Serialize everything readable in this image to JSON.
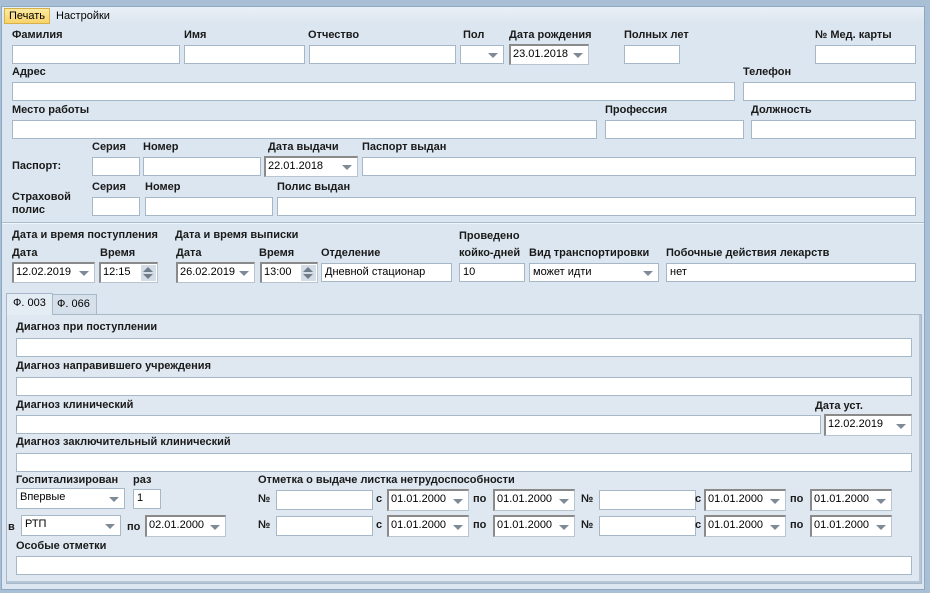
{
  "menu": {
    "print": "Печать",
    "settings": "Настройки"
  },
  "personal": {
    "last_name_label": "Фамилия",
    "last_name": "",
    "first_name_label": "Имя",
    "first_name": "",
    "patronymic_label": "Отчество",
    "patronymic": "",
    "sex_label": "Пол",
    "sex": "",
    "birth_date_label": "Дата рождения",
    "birth_date": "23.01.2018",
    "age_label": "Полных лет",
    "age": "",
    "card_no_label": "№ Мед. карты",
    "card_no": "",
    "address_label": "Адрес",
    "address": "",
    "phone_label": "Телефон",
    "phone": "",
    "workplace_label": "Место работы",
    "workplace": "",
    "profession_label": "Профессия",
    "profession": "",
    "position_label": "Должность",
    "position": ""
  },
  "passport": {
    "label": "Паспорт:",
    "series_label": "Серия",
    "series": "",
    "number_label": "Номер",
    "number": "",
    "issue_date_label": "Дата выдачи",
    "issue_date": "22.01.2018",
    "issued_by_label": "Паспорт выдан",
    "issued_by": ""
  },
  "insurance": {
    "label_line1": "Страховой",
    "label_line2": "полис",
    "series_label": "Серия",
    "series": "",
    "number_label": "Номер",
    "number": "",
    "issued_by_label": "Полис выдан",
    "issued_by": ""
  },
  "stay": {
    "admission_label": "Дата и время поступления",
    "discharge_label": "Дата и время выписки",
    "date_label": "Дата",
    "time_label": "Время",
    "admission_date": "12.02.2019",
    "admission_time": "12:15",
    "discharge_date": "26.02.2019",
    "discharge_time": "13:00",
    "department_label": "Отделение",
    "department": "Дневной стационар",
    "bed_days_label1": "Проведено",
    "bed_days_label2": "койко-дней",
    "bed_days": "10",
    "transport_label": "Вид транспортировки",
    "transport": "может идти",
    "side_effects_label": "Побочные действия лекарств",
    "side_effects": "нет"
  },
  "tabs": [
    "Ф. 003",
    "Ф. 066"
  ],
  "f003": {
    "diag_admission_label": "Диагноз при поступлении",
    "diag_admission": "",
    "diag_referral_label": "Диагноз направившего учреждения",
    "diag_referral": "",
    "diag_clinical_label": "Диагноз клинический",
    "diag_clinical": "",
    "diag_date_label": "Дата уст.",
    "diag_date": "12.02.2019",
    "diag_final_label": "Диагноз заключительный клинический",
    "diag_final": "",
    "hosp_label": "Госпитализирован",
    "hosp_value": "Впервые",
    "times_label": "раз",
    "times": "1",
    "in_label": "в",
    "in_value": "РТП",
    "to_label": "по",
    "to_date": "02.01.2000",
    "sick_leave_label": "Отметка о выдаче листка нетрудоспособности",
    "no_label": "№",
    "from_label": "с",
    "until_label": "по",
    "sick_leaves": [
      {
        "no": "",
        "from": "01.01.2000",
        "to": "01.01.2000"
      },
      {
        "no": "",
        "from": "01.01.2000",
        "to": "01.01.2000"
      },
      {
        "no": "",
        "from": "01.01.2000",
        "to": "01.01.2000"
      },
      {
        "no": "",
        "from": "01.01.2000",
        "to": "01.01.2000"
      }
    ],
    "notes_label": "Особые отметки",
    "notes": ""
  }
}
